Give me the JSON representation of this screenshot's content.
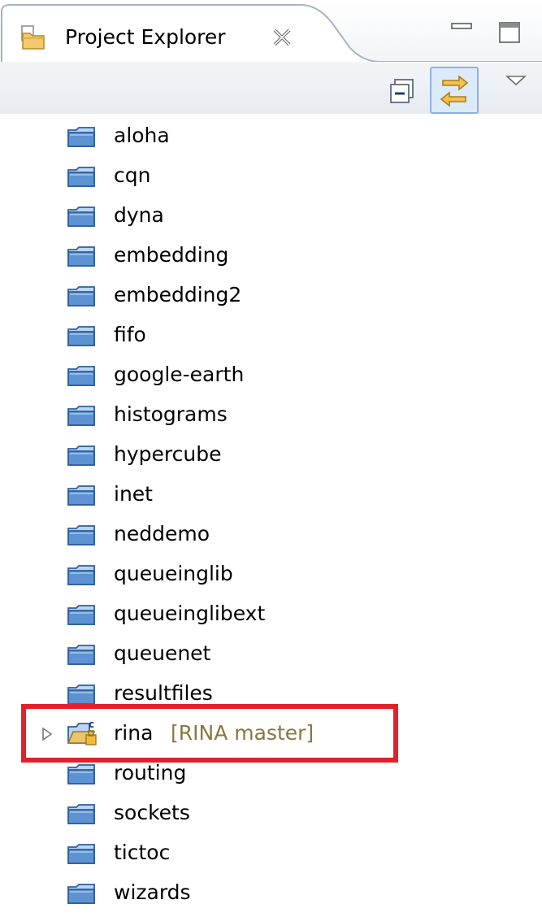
{
  "view": {
    "title": "Project Explorer",
    "tab_icon": "project-explorer-icon",
    "close_icon": "close-icon",
    "minimize_icon": "minimize-icon",
    "maximize_icon": "maximize-icon"
  },
  "toolbar": {
    "collapse_all_icon": "collapse-all-icon",
    "link_with_editor_icon": "link-with-editor-icon",
    "link_with_editor_active": true,
    "view_menu_icon": "chevron-down-icon"
  },
  "tree": {
    "projects": [
      {
        "name": "aloha",
        "icon": "closed-project-icon"
      },
      {
        "name": "cqn",
        "icon": "closed-project-icon"
      },
      {
        "name": "dyna",
        "icon": "closed-project-icon"
      },
      {
        "name": "embedding",
        "icon": "closed-project-icon"
      },
      {
        "name": "embedding2",
        "icon": "closed-project-icon"
      },
      {
        "name": "fifo",
        "icon": "closed-project-icon"
      },
      {
        "name": "google-earth",
        "icon": "closed-project-icon"
      },
      {
        "name": "histograms",
        "icon": "closed-project-icon"
      },
      {
        "name": "hypercube",
        "icon": "closed-project-icon"
      },
      {
        "name": "inet",
        "icon": "closed-project-icon"
      },
      {
        "name": "neddemo",
        "icon": "closed-project-icon"
      },
      {
        "name": "queueinglib",
        "icon": "closed-project-icon"
      },
      {
        "name": "queueinglibext",
        "icon": "closed-project-icon"
      },
      {
        "name": "queuenet",
        "icon": "closed-project-icon"
      },
      {
        "name": "resultfiles",
        "icon": "closed-project-icon"
      },
      {
        "name": "rina",
        "decoration": "[RINA master]",
        "icon": "open-git-project-icon",
        "expandable": true,
        "highlighted": true,
        "highlight_color": "#e5202a"
      },
      {
        "name": "routing",
        "icon": "closed-project-icon"
      },
      {
        "name": "sockets",
        "icon": "closed-project-icon"
      },
      {
        "name": "tictoc",
        "icon": "closed-project-icon"
      },
      {
        "name": "wizards",
        "icon": "closed-project-icon"
      }
    ]
  },
  "colors": {
    "decoration_text": "#8a7740",
    "highlight_border": "#e5202a",
    "folder_blue": "#4f86c8"
  }
}
